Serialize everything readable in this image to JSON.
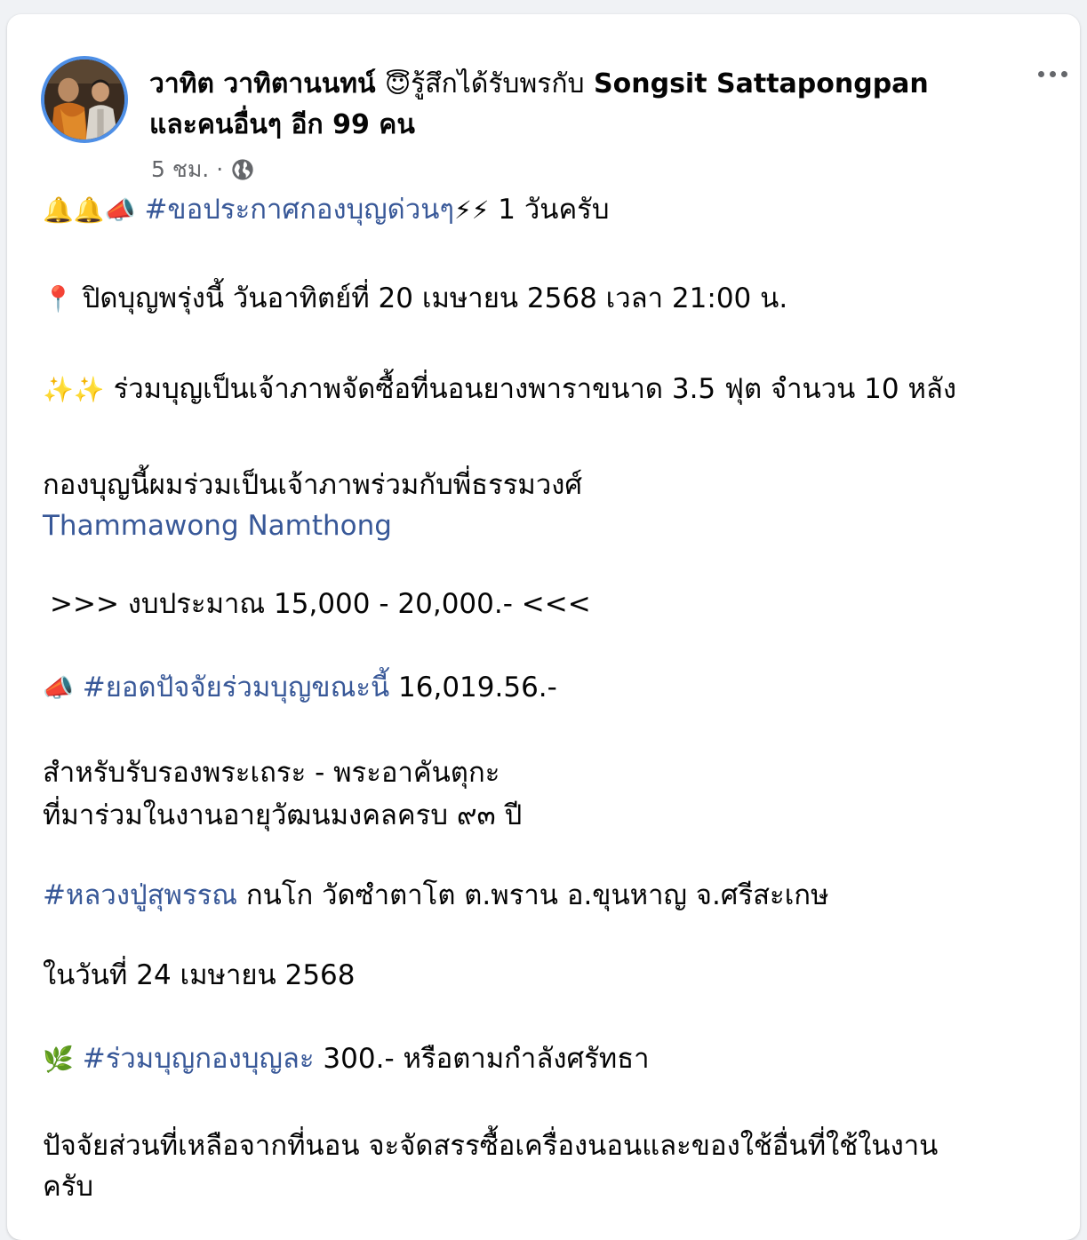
{
  "post": {
    "author": "วาทิต วาทิตานนทน์",
    "feeling_emoji": "😇",
    "feeling_text": "รู้สึกได้รับพรกับ",
    "tagged_person": "Songsit Sattapongpan",
    "others_text": "และคนอื่นๆ อีก 99 คน",
    "time": "5 ชม.",
    "separator": "·",
    "audience_icon": "globe-icon",
    "more_icon": "more-options-icon"
  },
  "body": {
    "l1_emoji": "🔔🔔📣",
    "l1_tag": "#ขอประกาศกองบุญด่วนๆ",
    "l1_bolts": "⚡⚡",
    "l1_text": "1 วันครับ",
    "l2_emoji": "📍",
    "l2_text": "ปิดบุญพรุ่งนี้ วันอาทิตย์ที่ 20 เมษายน 2568 เวลา 21:00 น.",
    "l3_emoji": "✨✨",
    "l3_text": "ร่วมบุญเป็นเจ้าภาพจัดซื้อที่นอนยางพาราขนาด 3.5 ฟุต  จำนวน 10 หลัง",
    "l4_text": "กองบุญนี้ผมร่วมเป็นเจ้าภาพร่วมกับพี่ธรรมวงศ์",
    "l5_link": "Thammawong Namthong",
    "l6_text": ">>> งบประมาณ 15,000 - 20,000.- <<<",
    "l7_emoji": "📣",
    "l7_tag": "#ยอดปัจจัยร่วมบุญขณะนี้",
    "l7_text": "16,019.56.-",
    "l8_text": "สำหรับรับรองพระเถระ - พระอาคันตุกะ",
    "l9_text": "ที่มาร่วมในงานอายุวัฒนมงคลครบ ๙๓ ปี",
    "l10_tag": "#หลวงปู่สุพรรณ",
    "l10_text": "กนโก  วัดซำตาโต ต.พราน อ.ขุนหาญ   จ.ศรีสะเกษ",
    "l11_text": "ในวันที่ 24 เมษายน 2568",
    "l12_emoji": "🌿",
    "l12_tag": "#ร่วมบุญกองบุญละ",
    "l12_text": "300.- หรือตามกำลังศรัทธา",
    "l13_text": "ปัจจัยส่วนที่เหลือจากที่นอน  จะจัดสรรซื้อเครื่องนอนและของใช้อื่นที่ใช้ในงาน",
    "l14_text": "ครับ"
  },
  "colors": {
    "link": "#385898",
    "meta": "#65676b",
    "avatar_ring": "#4e8fe6"
  }
}
